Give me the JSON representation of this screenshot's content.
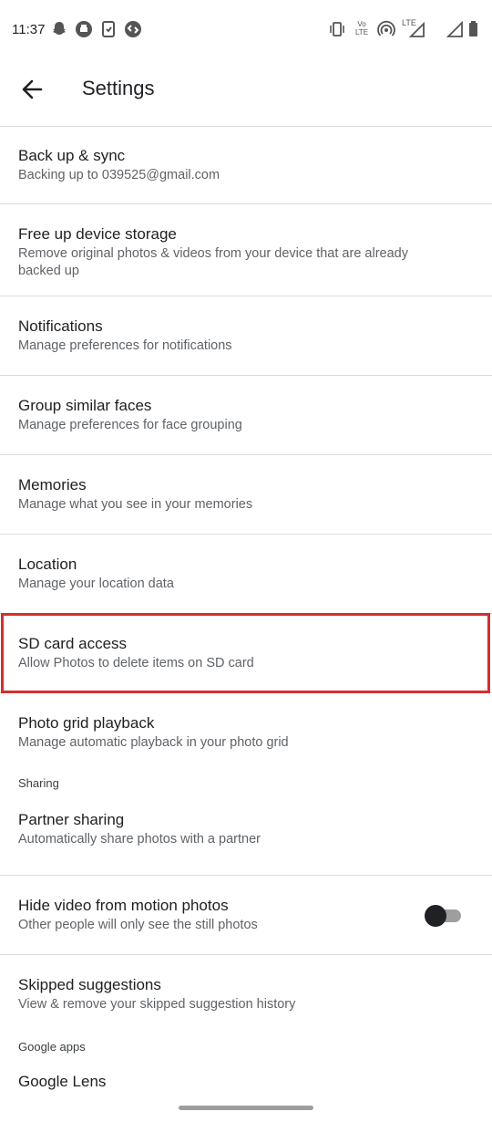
{
  "status_bar": {
    "time": "11:37",
    "notification_icons": [
      "snapchat-icon",
      "print-icon",
      "phone-sync-icon",
      "shazam-icon"
    ],
    "system_icons": [
      "vibrate-icon",
      "volte-icon",
      "hotspot-icon",
      "lte-signal-icon",
      "signal-icon",
      "battery-icon"
    ],
    "volte_text": "Vo LTE",
    "lte_text": "LTE"
  },
  "app_bar": {
    "title": "Settings"
  },
  "settings": {
    "backup": {
      "title": "Back up & sync",
      "subtitle": "Backing up to 039525@gmail.com"
    },
    "free_up": {
      "title": "Free up device storage",
      "subtitle": "Remove original photos & videos from your device that are already backed up"
    },
    "notifications": {
      "title": "Notifications",
      "subtitle": "Manage preferences for notifications"
    },
    "faces": {
      "title": "Group similar faces",
      "subtitle": "Manage preferences for face grouping"
    },
    "memories": {
      "title": "Memories",
      "subtitle": "Manage what you see in your memories"
    },
    "location": {
      "title": "Location",
      "subtitle": "Manage your location data"
    },
    "sd_card": {
      "title": "SD card access",
      "subtitle": "Allow Photos to delete items on SD card"
    },
    "grid_playback": {
      "title": "Photo grid playback",
      "subtitle": "Manage automatic playback in your photo grid"
    },
    "sharing_header": "Sharing",
    "partner": {
      "title": "Partner sharing",
      "subtitle": "Automatically share photos with a partner"
    },
    "hide_video": {
      "title": "Hide video from motion photos",
      "subtitle": "Other people will only see the still photos",
      "enabled": false
    },
    "skipped": {
      "title": "Skipped suggestions",
      "subtitle": "View & remove your skipped suggestion history"
    },
    "google_apps_header": "Google apps",
    "lens": {
      "title": "Google Lens"
    }
  },
  "colors": {
    "highlight": "#d32f2f",
    "divider": "#dadada"
  }
}
